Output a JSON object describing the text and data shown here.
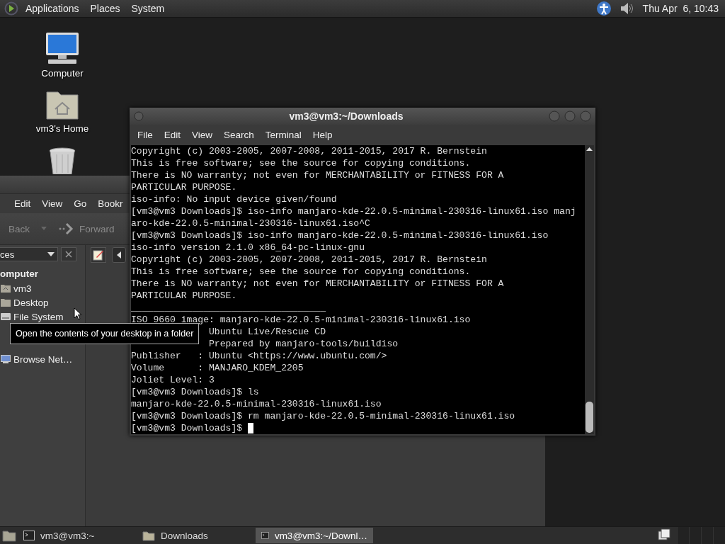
{
  "top_panel": {
    "menus": [
      "Applications",
      "Places",
      "System"
    ],
    "clock": "Thu Apr  6, 10:43"
  },
  "desktop_icons": [
    {
      "kind": "computer",
      "label": "Computer"
    },
    {
      "kind": "home",
      "label": "vm3's Home"
    },
    {
      "kind": "trash"
    }
  ],
  "file_manager": {
    "menu": [
      "Edit",
      "View",
      "Go",
      "Bookr"
    ],
    "toolbar": [
      "Back",
      "Forward"
    ],
    "places_combo": "ces",
    "sidebar": [
      {
        "kind": "heading",
        "label": "omputer"
      },
      {
        "kind": "home",
        "label": "vm3"
      },
      {
        "kind": "desktop",
        "label": "Desktop"
      },
      {
        "kind": "drive",
        "label": "File System"
      },
      {
        "kind": "network",
        "label": "Browse Net…"
      }
    ]
  },
  "tooltip": "Open the contents of your desktop in a folder",
  "terminal": {
    "title": "vm3@vm3:~/Downloads",
    "menu": [
      "File",
      "Edit",
      "View",
      "Search",
      "Terminal",
      "Help"
    ],
    "lines": [
      "Copyright (c) 2003-2005, 2007-2008, 2011-2015, 2017 R. Bernstein",
      "This is free software; see the source for copying conditions.",
      "There is NO warranty; not even for MERCHANTABILITY or FITNESS FOR A",
      "PARTICULAR PURPOSE.",
      "iso-info: No input device given/found",
      "[vm3@vm3 Downloads]$ iso-info manjaro-kde-22.0.5-minimal-230316-linux61.iso manj",
      "aro-kde-22.0.5-minimal-230316-linux61.iso^C",
      "[vm3@vm3 Downloads]$ iso-info manjaro-kde-22.0.5-minimal-230316-linux61.iso",
      "iso-info version 2.1.0 x86_64-pc-linux-gnu",
      "Copyright (c) 2003-2005, 2007-2008, 2011-2015, 2017 R. Bernstein",
      "This is free software; see the source for copying conditions.",
      "There is NO warranty; not even for MERCHANTABILITY or FITNESS FOR A",
      "PARTICULAR PURPOSE.",
      "___________________________________",
      "ISO 9660 image: manjaro-kde-22.0.5-minimal-230316-linux61.iso",
      "              Ubuntu Live/Rescue CD",
      "              Prepared by manjaro-tools/buildiso",
      "Publisher   : Ubuntu <https://www.ubuntu.com/>",
      "Volume      : MANJARO_KDEM_2205",
      "Joliet Level: 3",
      "[vm3@vm3 Downloads]$ ls",
      "manjaro-kde-22.0.5-minimal-230316-linux61.iso",
      "[vm3@vm3 Downloads]$ rm manjaro-kde-22.0.5-minimal-230316-linux61.iso",
      "[vm3@vm3 Downloads]$"
    ]
  },
  "taskbar": [
    {
      "kind": "terminal",
      "label": "vm3@vm3:~",
      "selected": false
    },
    {
      "kind": "folder",
      "label": "Downloads",
      "selected": false
    },
    {
      "kind": "terminal",
      "label": "vm3@vm3:~/Downl…",
      "selected": true
    }
  ]
}
